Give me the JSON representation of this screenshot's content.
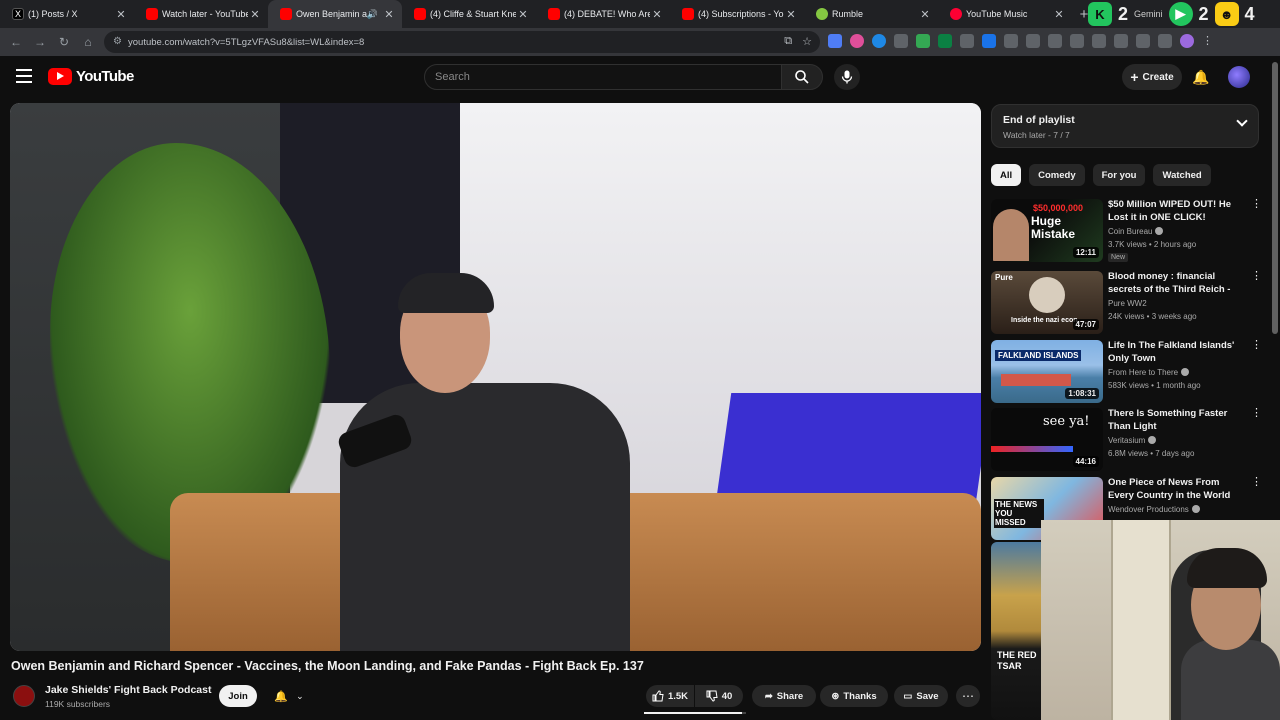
{
  "browser": {
    "tabs": [
      {
        "title": "(1) Posts / X",
        "icon": "x-icon",
        "active": false
      },
      {
        "title": "Watch later - YouTube",
        "icon": "youtube-icon",
        "active": false
      },
      {
        "title": "Owen Benjamin and",
        "icon": "youtube-icon",
        "active": true
      },
      {
        "title": "(4) Cliffe & Stuart Knech",
        "icon": "youtube-icon",
        "active": false
      },
      {
        "title": "(4) DEBATE! Who Are th",
        "icon": "youtube-icon",
        "active": false
      },
      {
        "title": "(4) Subscriptions - YouT",
        "icon": "youtube-icon",
        "active": false
      },
      {
        "title": "Rumble",
        "icon": "rumble-icon",
        "active": false
      },
      {
        "title": "YouTube Music",
        "icon": "youtube-music-icon",
        "active": false
      }
    ],
    "url": "youtube.com/watch?v=5TLgzVFASu8&list=WL&index=8",
    "ext_counts": [
      "2",
      "2",
      "4"
    ],
    "ext_label": "Gemini"
  },
  "yt": {
    "logo_text": "YouTube",
    "search_placeholder": "Search",
    "create_label": "Create"
  },
  "video": {
    "title": "Owen Benjamin and Richard Spencer - Vaccines, the Moon Landing, and Fake Pandas - Fight Back Ep. 137",
    "channel": "Jake Shields' Fight Back Podcast",
    "subscribers": "119K subscribers",
    "join_label": "Join",
    "likes": "1.5K",
    "dislikes": "40",
    "share_label": "Share",
    "thanks_label": "Thanks",
    "save_label": "Save",
    "like_ratio": 0.96
  },
  "playlist": {
    "title": "End of playlist",
    "subtitle": "Watch later - 7 / 7"
  },
  "chips": [
    "All",
    "Comedy",
    "For you",
    "Watched"
  ],
  "recommendations": [
    {
      "title": "$50 Million WIPED OUT! He Lost it in ONE CLICK!",
      "channel": "Coin Bureau",
      "verified": true,
      "meta": "3.7K views • 2 hours ago",
      "badge": "New",
      "duration": "12:11",
      "thumb_text": "Huge Mistake"
    },
    {
      "title": "Blood money : financial secrets of the Third Reich - episode 1 :...",
      "channel": "Pure WW2",
      "verified": false,
      "meta": "24K views • 3 weeks ago",
      "badge": "",
      "duration": "47:07",
      "thumb_text": "Inside the nazi econ"
    },
    {
      "title": "Life In The Falkland Islands' Only Town",
      "channel": "From Here to There",
      "verified": true,
      "meta": "583K views • 1 month ago",
      "badge": "",
      "duration": "1:08:31",
      "thumb_text": "FALKLAND ISLANDS"
    },
    {
      "title": "There Is Something Faster Than Light",
      "channel": "Veritasium",
      "verified": true,
      "meta": "6.8M views • 7 days ago",
      "badge": "",
      "duration": "44:16",
      "thumb_text": "see ya!"
    },
    {
      "title": "One Piece of News From Every Country in the World",
      "channel": "Wendover Productions",
      "verified": true,
      "meta": "",
      "badge": "",
      "duration": "",
      "thumb_text": "THE NEWS YOU MISSED"
    }
  ],
  "side_strip_text": "THE RED TSAR",
  "colors": {
    "yt_red": "#ff0000",
    "bg": "#0f0f0f",
    "chip_bg": "#272727"
  }
}
